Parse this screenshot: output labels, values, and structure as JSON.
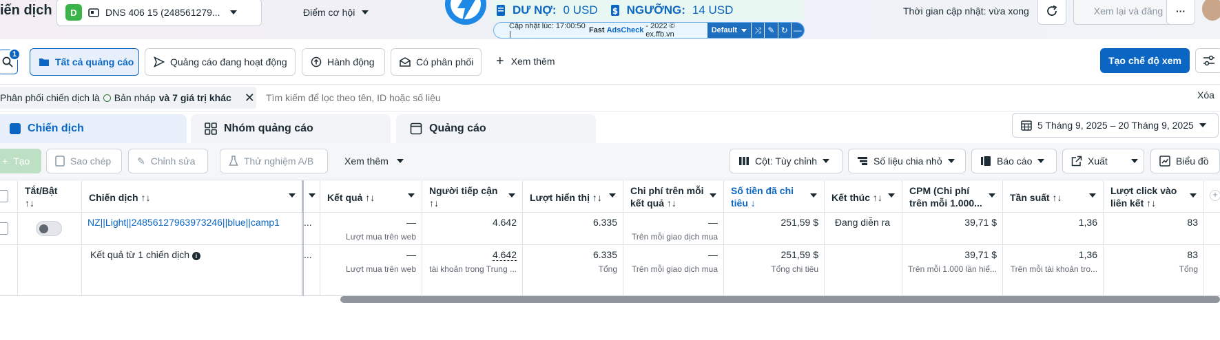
{
  "header": {
    "title": "iến dịch",
    "account_badge": "D",
    "account_name": "DNS 406 15 (248561279...",
    "opportunity": "Điểm cơ hội",
    "debt_label": "DƯ NỢ:",
    "debt_value": "0 USD",
    "threshold_label": "NGƯỠNG:",
    "threshold_value": "14 USD",
    "ext_update_time": "Cập nhật lúc: 17:00:50 |",
    "ext_fast": "Fast",
    "ext_brand": "AdsCheck",
    "ext_copyright": "- 2022 © ex.ffb.vn",
    "ext_mode": "Default",
    "update_time": "Thời gian cập nhật: vừa xong",
    "review_button": "Xem lại và đăng",
    "more_icon": "ellipsis-icon",
    "colors": {
      "brand": "#0a66c2",
      "badge": "#3bb44a",
      "bolt": "#1e88e5"
    }
  },
  "filters": {
    "search_badge": "1",
    "all_ads": "Tất cả quảng cáo",
    "active_ads": "Quảng cáo đang hoạt động",
    "actions": "Hành động",
    "has_delivery": "Có phân phối",
    "see_more": "Xem thêm",
    "create_view": "Tạo chế độ xem"
  },
  "filter_bar": {
    "chip_prefix": "Phân phối chiến dịch là",
    "chip_value": "Bản nháp",
    "chip_suffix": "và 7 giá trị khác",
    "search_placeholder": "Tìm kiếm để lọc theo tên, ID hoặc số liệu",
    "clear": "Xóa"
  },
  "tabs": {
    "campaigns": "Chiến dịch",
    "ad_sets": "Nhóm quảng cáo",
    "ads": "Quảng cáo",
    "date_range": "5 Tháng 9, 2025 – 20 Tháng 9, 2025"
  },
  "toolbar": {
    "create": "Tạo",
    "copy": "Sao chép",
    "edit": "Chỉnh sửa",
    "ab_test": "Thử nghiệm A/B",
    "more": "Xem thêm",
    "columns": "Cột: Tùy chỉnh",
    "breakdown": "Số liệu chia nhỏ",
    "reports": "Báo cáo",
    "export": "Xuất",
    "chart": "Biểu đồ"
  },
  "table": {
    "headers": {
      "toggle": "Tắt/Bật",
      "campaign": "Chiến dịch",
      "results": "Kết quả",
      "reach": "Người tiếp cận",
      "impressions": "Lượt hiển thị",
      "cost_per_result": "Chi phí trên mỗi kết quả",
      "amount_spent": "Số tiền đã chi tiêu",
      "ends": "Kết thúc",
      "cpm": "CPM (Chi phí trên mỗi 1.000...",
      "frequency": "Tần suất",
      "link_clicks": "Lượt click vào liên kết"
    },
    "sort_icon": "↑↓",
    "sort_desc_icon": "↓",
    "row": {
      "campaign_name": "NZ||Light||24856127963973246||blue||camp1",
      "results": "—",
      "results_sub": "Lượt mua trên web",
      "reach": "4.642",
      "impressions": "6.335",
      "cost_per_result": "—",
      "cost_per_result_sub": "Trên mỗi giao dịch mua",
      "amount_spent": "251,59 $",
      "ends": "Đang diễn ra",
      "cpm": "39,71 $",
      "frequency": "1,36",
      "link_clicks": "83",
      "truncated": "..."
    },
    "summary": {
      "label": "Kết quả từ 1 chiến dịch",
      "results": "—",
      "results_sub": "Lượt mua trên web",
      "reach": "4.642",
      "reach_sub": "tài khoản trong Trung ...",
      "impressions": "6.335",
      "impressions_sub": "Tổng",
      "cost_per_result": "—",
      "cost_per_result_sub": "Trên mỗi giao dịch mua",
      "amount_spent": "251,59 $",
      "amount_spent_sub": "Tổng chi tiêu",
      "cpm": "39,71 $",
      "cpm_sub": "Trên mỗi 1.000 lần hiể...",
      "frequency": "1,36",
      "frequency_sub": "Trên mỗi tài khoản tro...",
      "link_clicks": "83",
      "link_clicks_sub": "Tổng",
      "truncated": "..."
    }
  }
}
